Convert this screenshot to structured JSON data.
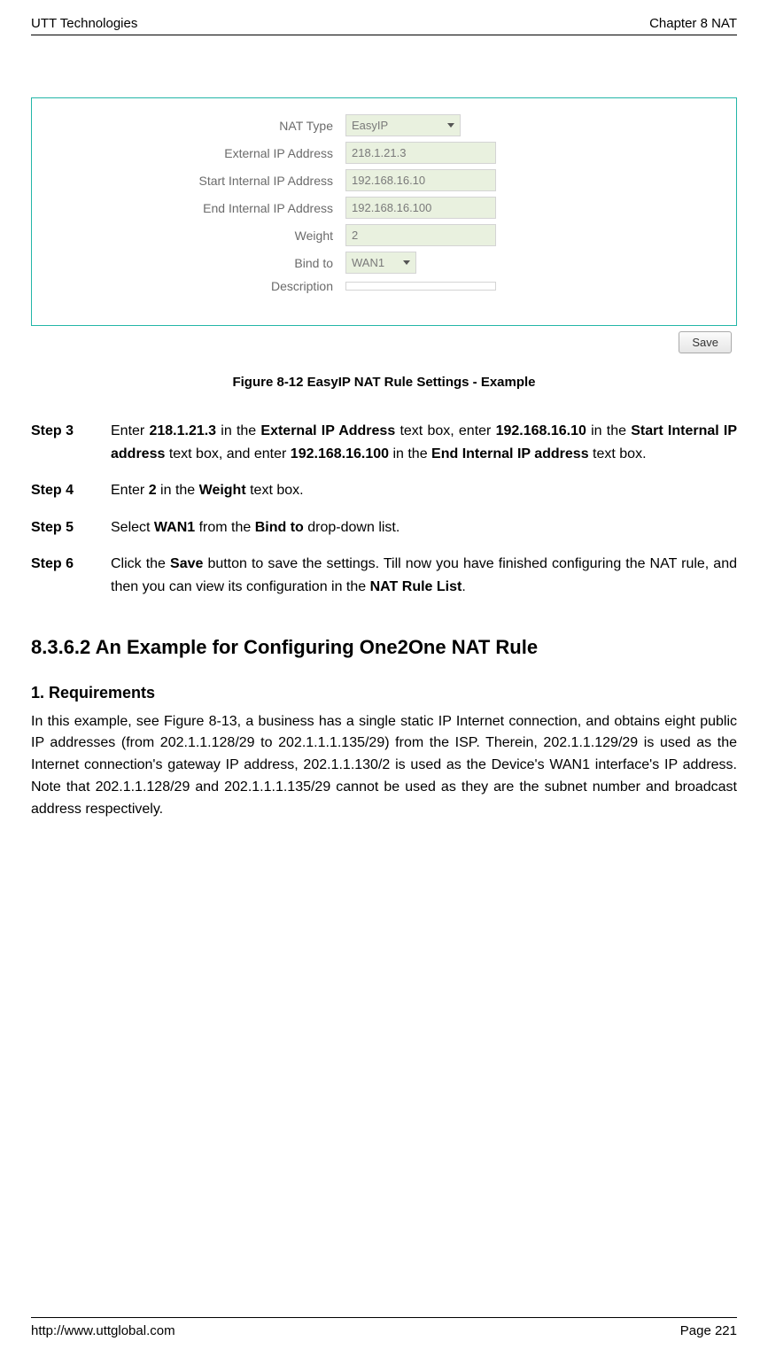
{
  "header": {
    "left": "UTT Technologies",
    "right": "Chapter 8 NAT"
  },
  "form": {
    "labels": {
      "nat_type": "NAT Type",
      "ext_ip": "External IP Address",
      "start_ip": "Start Internal IP Address",
      "end_ip": "End Internal IP Address",
      "weight": "Weight",
      "bind": "Bind to",
      "desc": "Description"
    },
    "values": {
      "nat_type": "EasyIP",
      "ext_ip": "218.1.21.3",
      "start_ip": "192.168.16.10",
      "end_ip": "192.168.16.100",
      "weight": "2",
      "bind": "WAN1",
      "desc": ""
    },
    "save_label": "Save"
  },
  "figure_caption": "Figure 8-12 EasyIP NAT Rule Settings - Example",
  "steps": {
    "s3label": "Step 3",
    "s3_p1": "Enter ",
    "s3_b1": "218.1.21.3",
    "s3_p2": " in the ",
    "s3_b2": "External IP Address",
    "s3_p3": " text box, enter ",
    "s3_b3": "192.168.16.10",
    "s3_p4": " in the ",
    "s3_b4": "Start Internal IP address",
    "s3_p5": " text box, and enter ",
    "s3_b5": "192.168.16.100",
    "s3_p6": " in the ",
    "s3_b6": "End Internal IP address",
    "s3_p7": " text box.",
    "s4label": "Step 4",
    "s4_p1": "Enter ",
    "s4_b1": "2",
    "s4_p2": " in the ",
    "s4_b2": "Weight",
    "s4_p3": " text box.",
    "s5label": "Step 5",
    "s5_p1": "Select ",
    "s5_b1": "WAN1",
    "s5_p2": " from the ",
    "s5_b2": "Bind to",
    "s5_p3": " drop-down list.",
    "s6label": "Step 6",
    "s6_p1": "Click the ",
    "s6_b1": "Save",
    "s6_p2": " button to save the settings. Till now you have finished configuring the NAT rule, and then you can view its configuration in the ",
    "s6_b2": "NAT Rule List",
    "s6_p3": "."
  },
  "section_heading": "8.3.6.2   An Example for Configuring One2One NAT Rule",
  "sub_heading": "1.   Requirements",
  "paragraph": "In this example, see Figure 8-13, a business has a single static IP Internet connection, and obtains eight public IP addresses (from 202.1.1.128/29 to 202.1.1.1.135/29) from the ISP. Therein, 202.1.1.129/29 is used as the Internet connection's gateway IP address, 202.1.1.130/2 is used as the Device's WAN1 interface's IP address. Note that 202.1.1.128/29 and 202.1.1.1.135/29 cannot be used as they are the subnet number and broadcast address respectively.",
  "footer": {
    "url": "http://www.uttglobal.com",
    "page": "Page  221"
  }
}
